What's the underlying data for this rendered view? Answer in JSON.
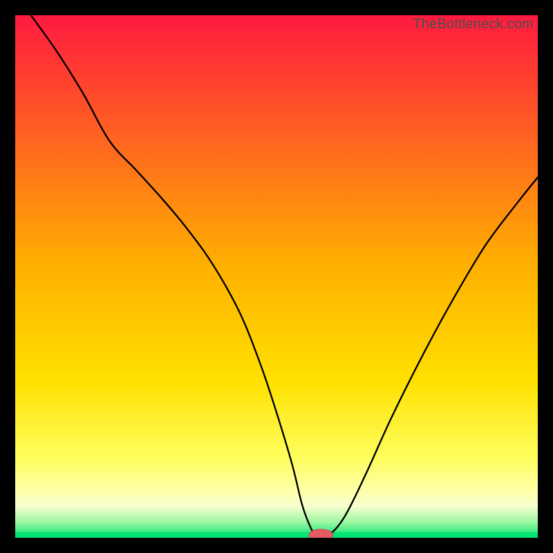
{
  "watermark": "TheBottleneck.com",
  "colors": {
    "frame": "#000000",
    "top": "#ff1a3f",
    "mid": "#ffd400",
    "pale": "#ffffa8",
    "band": "#f6ffd0",
    "green": "#00e573",
    "curve": "#000000",
    "marker_fill": "#e55b63",
    "marker_stroke": "#d9434c"
  },
  "chart_data": {
    "type": "line",
    "title": "",
    "xlabel": "",
    "ylabel": "",
    "xlim": [
      0,
      100
    ],
    "ylim": [
      0,
      100
    ],
    "x": [
      3,
      8,
      13,
      18,
      23,
      28,
      33,
      38,
      43,
      47,
      50,
      53,
      55,
      57,
      58,
      60,
      63,
      67,
      72,
      78,
      84,
      90,
      96,
      100
    ],
    "values": [
      100,
      93,
      85,
      76,
      70.5,
      65,
      59,
      52,
      43,
      33,
      24,
      14,
      6,
      1,
      0,
      0.5,
      4,
      12,
      23,
      35,
      46,
      56,
      64,
      69
    ],
    "marker": {
      "x": 58.5,
      "y": 0,
      "rx": 2.3,
      "ry": 1.1
    },
    "note": "x/y are percentages of the plot area; y is measured from the bottom (0 = baseline, 100 = top)."
  }
}
